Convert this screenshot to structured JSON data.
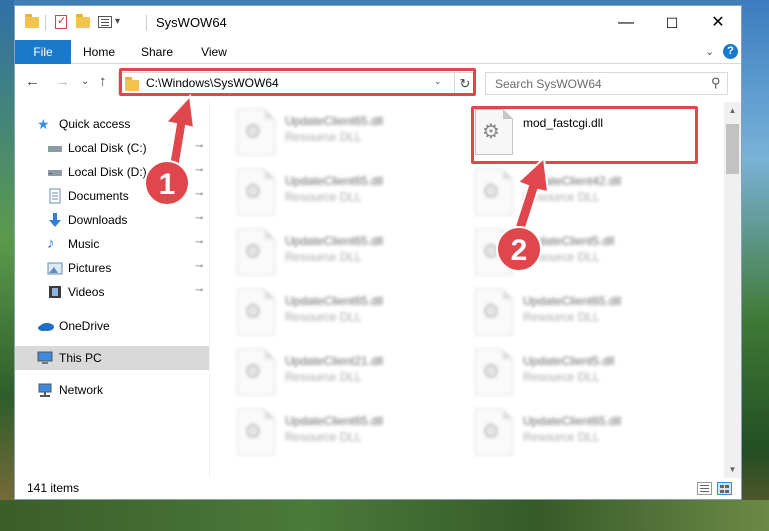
{
  "window": {
    "title": "SysWOW64",
    "quick_toolbar_dropdown": "▾",
    "controls": {
      "minimize": "—",
      "maximize": "☐",
      "close": "✕"
    }
  },
  "ribbon": {
    "tabs": [
      "File",
      "Home",
      "Share",
      "View"
    ],
    "collapse_glyph": "⌄",
    "help_glyph": "?"
  },
  "navigation": {
    "back": "←",
    "forward": "→",
    "recent": "⌄",
    "up": "↑",
    "address": "C:\\Windows\\SysWOW64",
    "address_dropdown": "⌄",
    "refresh": "↻",
    "search_placeholder": "Search SysWOW64"
  },
  "sidebar": {
    "items": [
      {
        "label": "Quick access",
        "icon": "star-icon",
        "pinned": false
      },
      {
        "label": "Local Disk (C:)",
        "icon": "drive-icon",
        "pinned": true
      },
      {
        "label": "Local Disk (D:)",
        "icon": "drive-icon",
        "pinned": true
      },
      {
        "label": "Documents",
        "icon": "documents-icon",
        "pinned": true
      },
      {
        "label": "Downloads",
        "icon": "download-icon",
        "pinned": true
      },
      {
        "label": "Music",
        "icon": "music-icon",
        "pinned": true
      },
      {
        "label": "Pictures",
        "icon": "pictures-icon",
        "pinned": true
      },
      {
        "label": "Videos",
        "icon": "videos-icon",
        "pinned": true
      },
      {
        "label": "OneDrive",
        "icon": "cloud-icon",
        "pinned": false
      },
      {
        "label": "This PC",
        "icon": "computer-icon",
        "pinned": false,
        "selected": true
      },
      {
        "label": "Network",
        "icon": "network-icon",
        "pinned": false
      }
    ],
    "pin_glyph": "📌"
  },
  "files": {
    "left_column": [
      {
        "name": "UpdateClient65.dll",
        "type": "Resource DLL"
      },
      {
        "name": "UpdateClient65.dll",
        "type": "Resource DLL"
      },
      {
        "name": "UpdateClient65.dll",
        "type": "Resource DLL"
      },
      {
        "name": "UpdateClient65.dll",
        "type": "Resource DLL"
      },
      {
        "name": "UpdateClient21.dll",
        "type": "Resource DLL"
      },
      {
        "name": "UpdateClient65.dll",
        "type": "Resource DLL"
      }
    ],
    "right_column": [
      {
        "name": "mod_fastcgi.dll",
        "type": "",
        "highlighted": true
      },
      {
        "name": "UpdateClient42.dll",
        "type": "Resource DLL"
      },
      {
        "name": "UpdateClient5.dll",
        "type": "Resource DLL"
      },
      {
        "name": "UpdateClient65.dll",
        "type": "Resource DLL"
      },
      {
        "name": "UpdateClient5.dll",
        "type": "Resource DLL"
      },
      {
        "name": "UpdateClient65.dll",
        "type": "Resource DLL"
      }
    ],
    "gear_glyph": "⚙"
  },
  "status": {
    "item_count": "141 items"
  },
  "annotations": {
    "step1": "1",
    "step2": "2",
    "color": "#e0474c"
  },
  "scrollbar": {
    "up": "▲",
    "down": "▼"
  }
}
